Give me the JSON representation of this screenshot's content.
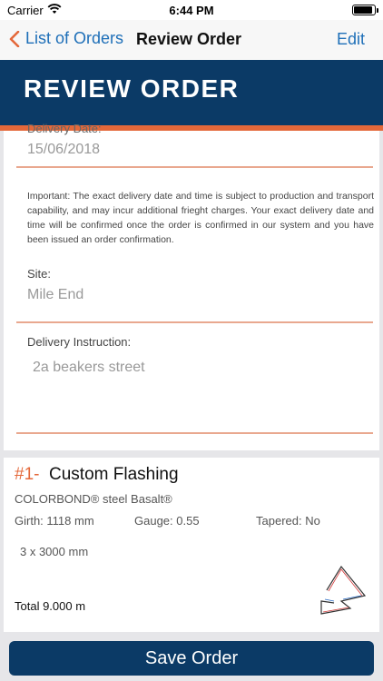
{
  "status": {
    "carrier": "Carrier",
    "time": "6:44 PM",
    "battery_level": 0.9
  },
  "nav": {
    "back_label": "List of Orders",
    "title": "Review Order",
    "edit_label": "Edit"
  },
  "banner": {
    "title": "REVIEW ORDER"
  },
  "delivery": {
    "date_label": "Delivery Date:",
    "date_value": "15/06/2018",
    "note": "Important: The exact delivery date and time is subject to production and transport capability, and may incur additional frieght charges. Your exact delivery date and time will be confirmed once the order is confirmed in our system and you have been issued an order confirmation.",
    "site_label": "Site:",
    "site_value": "Mile End",
    "instruction_label": "Delivery Instruction:",
    "instruction_value": "2a beakers street"
  },
  "item": {
    "number": "#1-",
    "name": "Custom Flashing",
    "material": "COLORBOND® steel  Basalt®",
    "girth": "Girth: 1118 mm",
    "gauge": "Gauge: 0.55",
    "tapered": "Tapered: No",
    "quantity": "3 x 3000 mm",
    "total": "Total 9.000 m"
  },
  "footer": {
    "save_label": "Save Order"
  },
  "colors": {
    "navy": "#0b3a66",
    "accent": "#e4683a",
    "link": "#1e6fb8"
  },
  "icons": {
    "back": "chevron-left-icon",
    "wifi": "wifi-icon",
    "battery": "battery-icon",
    "drawing": "flashing-profile-icon"
  }
}
